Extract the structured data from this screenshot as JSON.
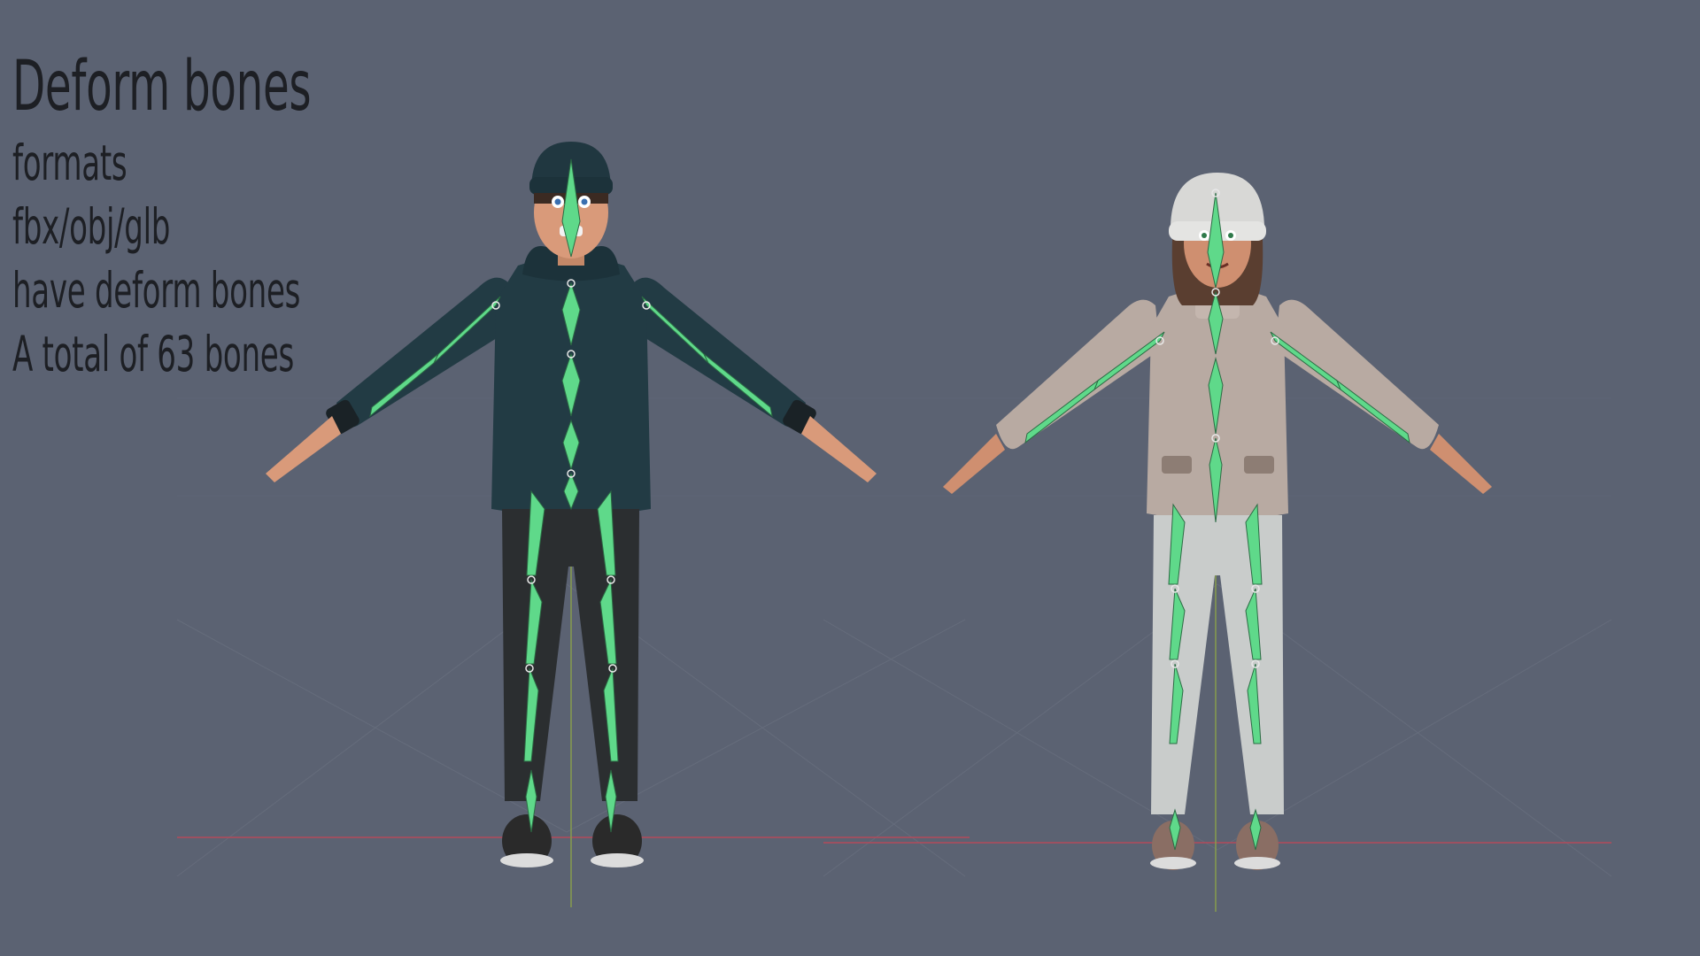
{
  "overlay": {
    "title": "Deform bones",
    "lines": [
      "formats",
      "fbx/obj/glb",
      "have deform bones",
      "A total of 63 bones"
    ]
  },
  "scene": {
    "background_color": "#5b6272",
    "bone_color": "#5fd98a",
    "figures": [
      {
        "name": "male-character",
        "jacket_color": "#223b44",
        "pants_color": "#2b2e30",
        "hat_color": "#203740",
        "skin_color": "#d99a7a",
        "shoe_color": "#2a2a2a"
      },
      {
        "name": "female-character",
        "jacket_color": "#b8aaa2",
        "pants_color": "#c9cccb",
        "hat_color": "#d8d8d6",
        "skin_color": "#cf8f70",
        "shoe_color": "#8a6e64"
      }
    ]
  }
}
